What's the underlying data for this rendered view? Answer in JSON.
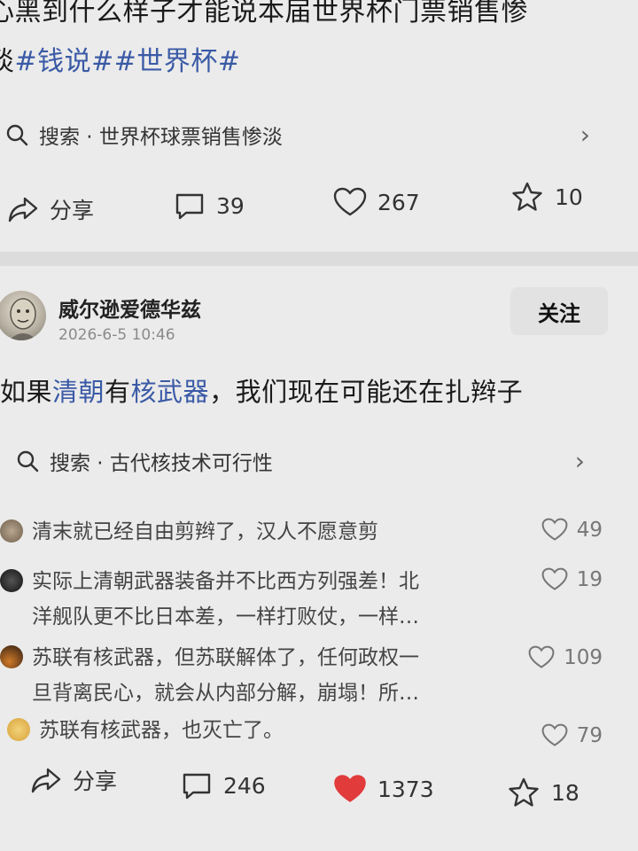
{
  "post1": {
    "text_line1": "心黑到什么样子才能说本届世界杯门票销售惨",
    "text_line2_prefix": "淡",
    "tags": "#钱说##世界杯#",
    "search_text": "搜索 · 世界杯球票销售惨淡",
    "share_label": "分享",
    "comments_count": "39",
    "likes_count": "267",
    "favorites_count": "10"
  },
  "post2": {
    "author_name": "威尔逊爱德华兹",
    "timestamp": "2026-6-5 10:46",
    "follow_label": "关注",
    "text_before": "如果",
    "link1": "清朝",
    "text_mid": "有",
    "link2": "核武器",
    "text_after": "，我们现在可能还在扎辫子",
    "search_text": "搜索 · 古代核技术可行性",
    "comments": [
      {
        "line1": "清末就已经自由剪辫了，汉人不愿意剪",
        "line2": "",
        "likes": "49"
      },
      {
        "line1": "实际上清朝武器装备并不比西方列强差！北",
        "line2": "洋舰队更不比日本差，一样打败仗，一样…",
        "likes": "19"
      },
      {
        "line1": "苏联有核武器，但苏联解体了，任何政权一",
        "line2": "旦背离民心，就会从内部分解，崩塌！所…",
        "likes": "109"
      },
      {
        "line1": "苏联有核武器，也灭亡了。",
        "line2": "",
        "likes": "79"
      }
    ],
    "share_label": "分享",
    "comments_count": "246",
    "likes_count": "1373",
    "favorites_count": "18"
  },
  "colors": {
    "link": "#3a5aa6",
    "liked_heart": "#e23b3b",
    "background": "#ebebeb"
  },
  "icons": [
    "search-icon",
    "chevron-right-icon",
    "share-icon",
    "comment-icon",
    "heart-icon",
    "star-icon",
    "avatar"
  ]
}
